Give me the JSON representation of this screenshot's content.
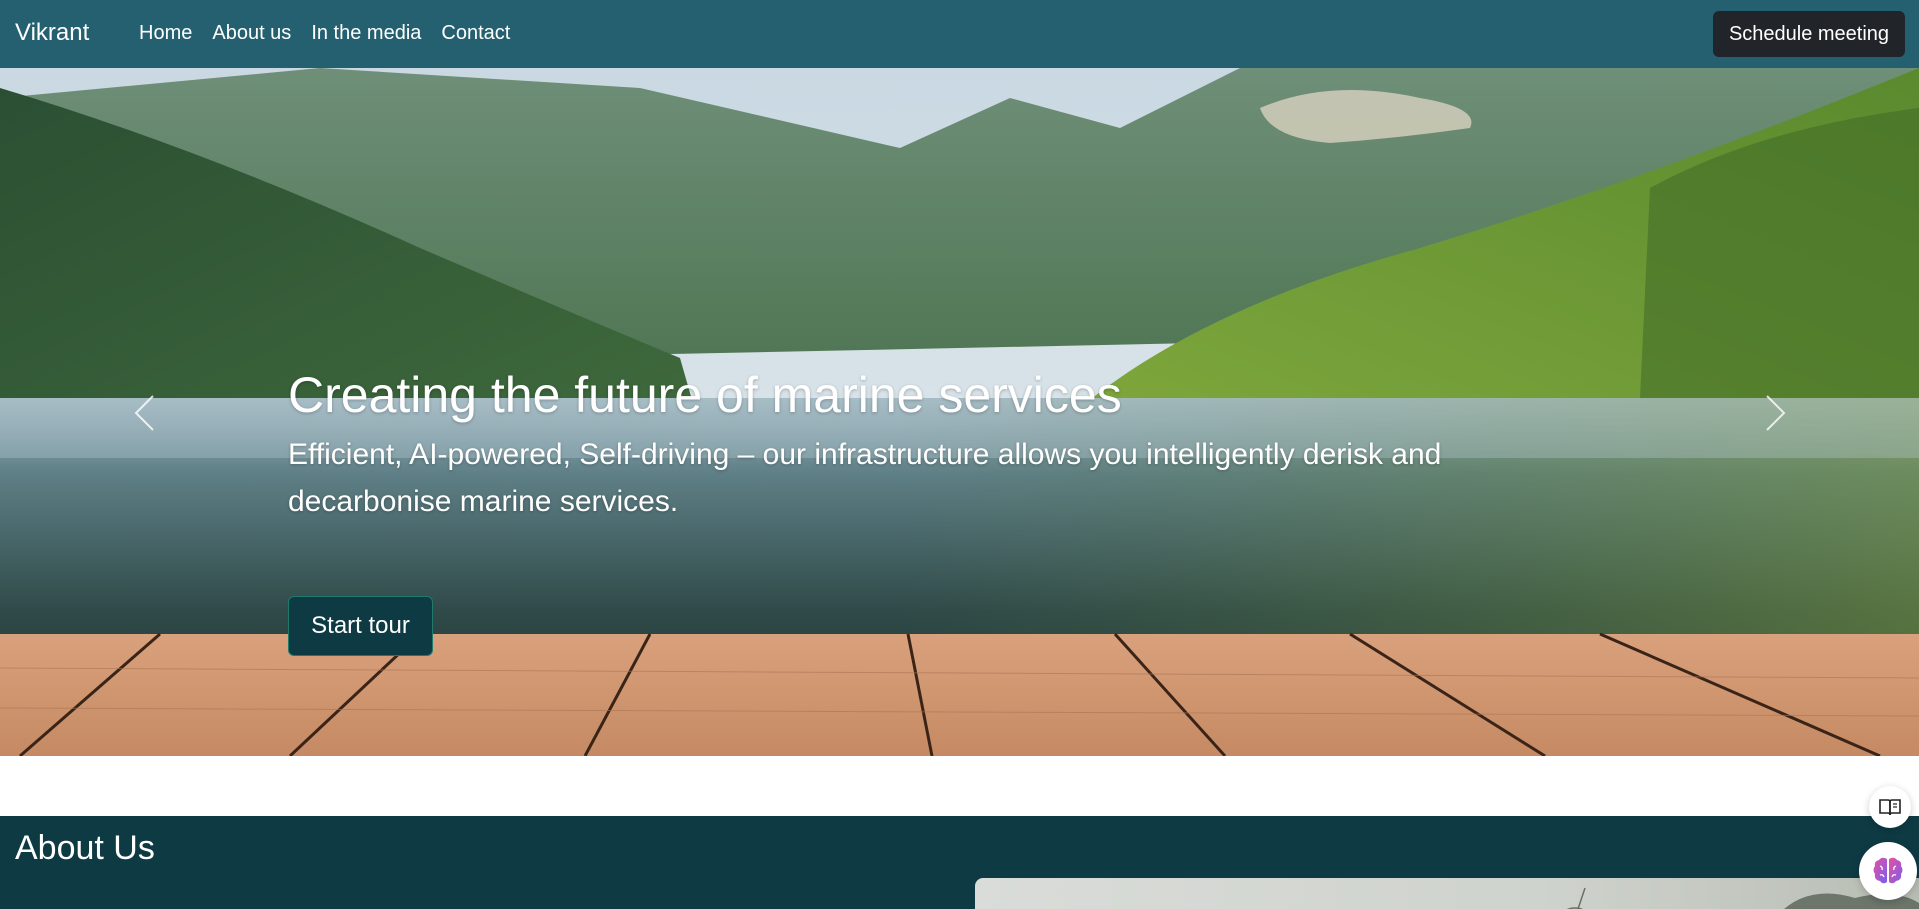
{
  "navbar": {
    "brand": "Vikrant",
    "links": [
      "Home",
      "About us",
      "In the media",
      "Contact"
    ],
    "cta": "Schedule meeting",
    "background": "#246070"
  },
  "hero": {
    "title": "Creating the future of marine services",
    "subtitle": "Efficient, AI-powered, Self-driving – our infrastructure allows you intelligently derisk and decarbonise marine services.",
    "button": "Start tour",
    "prev_icon": "chevron-left-icon",
    "next_icon": "chevron-right-icon"
  },
  "about": {
    "title": "About Us",
    "background": "#0e3a44"
  },
  "floating": {
    "reader_icon": "book-open-icon",
    "ai_icon": "brain-icon"
  }
}
